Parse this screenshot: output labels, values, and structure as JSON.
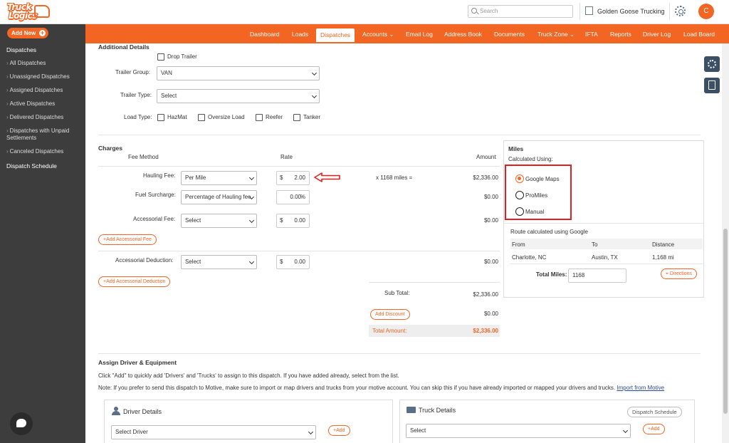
{
  "header": {
    "logo_line1": "Truck",
    "logo_line2": "Logics",
    "search_placeholder": "Search",
    "company": "Golden Goose Trucking",
    "avatar_initial": "C"
  },
  "sidebar": {
    "add_new": "Add New",
    "section": "Dispatches",
    "items": [
      {
        "label": "All Dispatches"
      },
      {
        "label": "Unassigned Dispatches"
      },
      {
        "label": "Assigned Dispatches"
      },
      {
        "label": "Active Dispatches"
      },
      {
        "label": "Delivered Dispatches"
      },
      {
        "label": "Dispatches with Unpaid Settlements"
      },
      {
        "label": "Canceled Dispatches"
      }
    ],
    "schedule": "Dispatch Schedule"
  },
  "nav": {
    "items": [
      "Dashboard",
      "Loads",
      "Dispatches",
      "Accounts ⌄",
      "Email Log",
      "Address Book",
      "Documents",
      "Truck Zone ⌄",
      "IFTA",
      "Reports",
      "Driver Log",
      "Load Board"
    ],
    "active": "Dispatches"
  },
  "additional": {
    "title": "Additional Details",
    "drop_trailer": "Drop Trailer",
    "trailer_group_label": "Trailer Group:",
    "trailer_group_value": "VAN",
    "trailer_type_label": "Trailer Type:",
    "trailer_type_value": "Select",
    "load_type_label": "Load Type:",
    "load_types": [
      "HazMat",
      "Oversize Load",
      "Reefer",
      "Tanker"
    ]
  },
  "charges": {
    "title": "Charges",
    "col_fee_method": "Fee Method",
    "col_rate": "Rate",
    "col_amount": "Amount",
    "hauling_label": "Hauling Fee:",
    "hauling_method": "Per Mile",
    "hauling_currency": "$",
    "hauling_rate": "2.00",
    "hauling_calc": "x 1168 miles =",
    "hauling_amount": "$2,336.00",
    "fuel_label": "Fuel Surcharge:",
    "fuel_method": "Percentage of Hauling fee",
    "fuel_rate": "0.00",
    "fuel_unit": "%",
    "fuel_amount": "$0.00",
    "accessorial_label": "Accessorial Fee:",
    "accessorial_method": "Select",
    "accessorial_currency": "$",
    "accessorial_rate": "0.00",
    "accessorial_amount": "$0.00",
    "add_accessorial_fee": "+Add Accessorial Fee",
    "deduction_label": "Accessorial Deduction:",
    "deduction_method": "Select",
    "deduction_currency": "$",
    "deduction_rate": "0.00",
    "deduction_amount": "$0.00",
    "add_accessorial_deduction": "+Add Accessorial Deduction",
    "subtotal_label": "Sub Total:",
    "subtotal": "$2,336.00",
    "add_discount": "Add Discount",
    "discount": "$0.00",
    "total_label": "Total Amount:",
    "total": "$2,336.00"
  },
  "miles": {
    "title": "Miles",
    "calc_label": "Calculated Using:",
    "options": [
      "Google Maps",
      "ProMiles",
      "Manual"
    ],
    "selected": "Google Maps",
    "route_note": "Route calculated using Google",
    "col_from": "From",
    "col_to": "To",
    "col_distance": "Distance",
    "from": "Charlotte, NC",
    "to": "Austin, TX",
    "distance": "1,168 mi",
    "total_label": "Total Miles:",
    "total": "1168",
    "directions": "Directions"
  },
  "assign": {
    "title": "Assign Driver & Equipment",
    "line1": "Click \"Add\" to quickly add 'Drivers' and 'Trucks' to assign to this dispatch. If you have added already, select from the list.",
    "line2": "Note: If you prefer to send this dispatch to Motive, make sure to import or map drivers and trucks from your motive account. You can skip this if you have already imported or mapped your drivers and trucks.",
    "import_link": "Import from Motive",
    "driver_title": "Driver Details",
    "driver_select": "Select Driver",
    "driver_add": "+Add",
    "truck_title": "Truck Details",
    "truck_schedule": "Dispatch Schedule",
    "truck_select": "Select",
    "truck_add": "+Add"
  },
  "colors": {
    "brand": "#f26522",
    "sidebar": "#3d3d3d",
    "highlight": "#e02020"
  }
}
